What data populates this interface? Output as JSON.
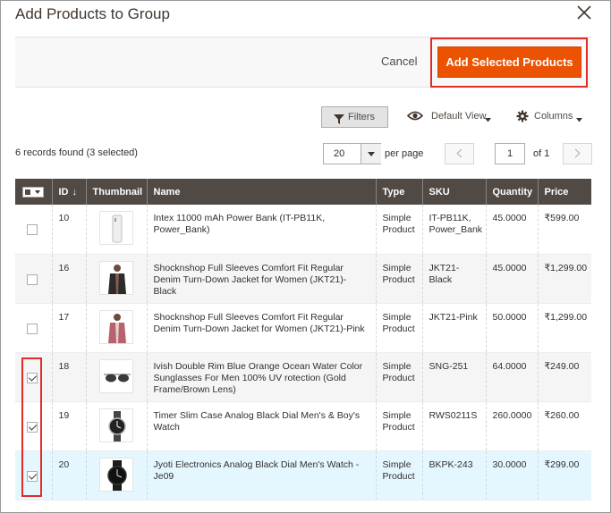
{
  "modal": {
    "title": "Add Products to Group"
  },
  "actions": {
    "cancel_label": "Cancel",
    "add_label": "Add Selected Products"
  },
  "toolbar": {
    "filters_label": "Filters",
    "view_label": "Default View",
    "columns_label": "Columns"
  },
  "paging": {
    "records_text": "6 records found (3 selected)",
    "per_page_value": "20",
    "per_page_label": "per page",
    "current_page": "1",
    "of_text": "of 1"
  },
  "grid": {
    "columns": [
      "ID",
      "Thumbnail",
      "Name",
      "Type",
      "SKU",
      "Quantity",
      "Price"
    ],
    "sort_arrow": "↓",
    "rows": [
      {
        "checked": false,
        "id": "10",
        "name": "Intex 11000 mAh Power Bank (IT-PB11K, Power_Bank)",
        "type": "Simple Product",
        "sku": "IT-PB11K, Power_Bank",
        "qty": "45.0000",
        "price": "₹599.00",
        "thumb": "power-bank"
      },
      {
        "checked": false,
        "id": "16",
        "name": "Shocknshop Full Sleeves Comfort Fit Regular Denim Turn-Down Jacket for Women (JKT21)-Black",
        "type": "Simple Product",
        "sku": "JKT21-Black",
        "qty": "45.0000",
        "price": "₹1,299.00",
        "thumb": "jacket-black"
      },
      {
        "checked": false,
        "id": "17",
        "name": "Shocknshop Full Sleeves Comfort Fit Regular Denim Turn-Down Jacket for Women (JKT21)-Pink",
        "type": "Simple Product",
        "sku": "JKT21-Pink",
        "qty": "50.0000",
        "price": "₹1,299.00",
        "thumb": "jacket-pink"
      },
      {
        "checked": true,
        "id": "18",
        "name": "Ivish Double Rim Blue Orange Ocean Water Color Sunglasses For Men 100% UV rotection (Gold Frame/Brown Lens)",
        "type": "Simple Product",
        "sku": "SNG-251",
        "qty": "64.0000",
        "price": "₹249.00",
        "thumb": "sunglasses"
      },
      {
        "checked": true,
        "id": "19",
        "name": "Timer Slim Case Analog Black Dial Men's & Boy's Watch",
        "type": "Simple Product",
        "sku": "RWS0211S",
        "qty": "260.0000",
        "price": "₹260.00",
        "thumb": "watch-silver"
      },
      {
        "checked": true,
        "id": "20",
        "name": "Jyoti Electronics Analog Black Dial Men's Watch - Je09",
        "type": "Simple Product",
        "sku": "BKPK-243",
        "qty": "30.0000",
        "price": "₹299.00",
        "thumb": "watch-black"
      }
    ]
  },
  "colors": {
    "accent": "#eb5202",
    "header_bg": "#514943",
    "highlight": "#e02b27",
    "selected_row": "#e5f7fe"
  }
}
